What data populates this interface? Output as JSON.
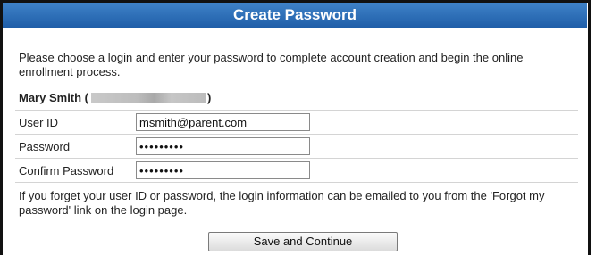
{
  "header": {
    "title": "Create Password"
  },
  "intro_text": "Please choose a login and enter your password to complete account creation and begin the online enrollment process.",
  "account": {
    "name_prefix": "Mary Smith (",
    "name_suffix": ")"
  },
  "form": {
    "user_id_label": "User ID",
    "user_id_value": "msmith@parent.com",
    "password_label": "Password",
    "password_value": "•••••••••",
    "confirm_label": "Confirm Password",
    "confirm_value": "•••••••••"
  },
  "footer_note": "If you forget your user ID or password, the login information can be emailed to you from the 'Forgot my password' link on the login page.",
  "actions": {
    "save_label": "Save and Continue"
  },
  "colors": {
    "title_bar": "#2b6cb8",
    "title_text": "#ffffff",
    "border": "#111111"
  }
}
